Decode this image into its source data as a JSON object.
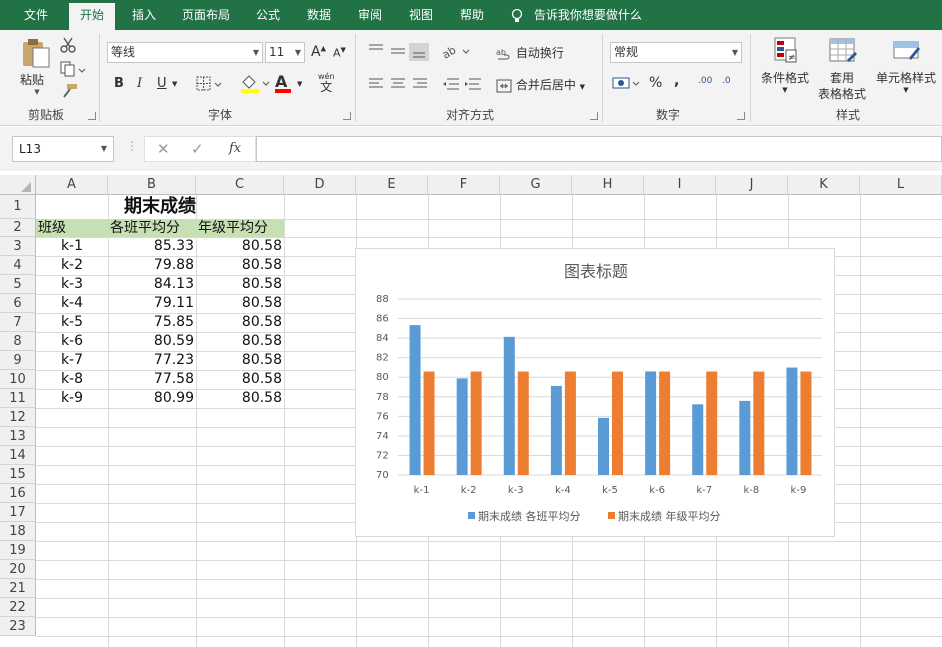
{
  "menu": {
    "tabs": [
      "文件",
      "开始",
      "插入",
      "页面布局",
      "公式",
      "数据",
      "审阅",
      "视图",
      "帮助"
    ],
    "tell_me": "告诉我你想要做什么"
  },
  "ribbon": {
    "clipboard": {
      "paste": "粘贴",
      "label": "剪贴板"
    },
    "font": {
      "name": "等线",
      "size": "11",
      "grow": "A",
      "shrink": "A",
      "bold": "B",
      "italic": "I",
      "underline": "U",
      "font_color_letter": "A",
      "phonetic_top": "wén",
      "phonetic_bottom": "文",
      "label": "字体"
    },
    "alignment": {
      "wrap": "自动换行",
      "merge": "合并后居中",
      "label": "对齐方式"
    },
    "number": {
      "format": "常规",
      "percent": "%",
      "comma": ",",
      "inc_decimal": ".00",
      "dec_decimal": ".0",
      "label": "数字"
    },
    "styles": {
      "conditional": "条件格式",
      "table_line1": "套用",
      "table_line2": "表格格式",
      "cell": "单元格样式",
      "label": "样式"
    }
  },
  "formula_bar": {
    "name_box": "L13",
    "fx": "fx",
    "formula": ""
  },
  "columns": [
    "A",
    "B",
    "C",
    "D",
    "E",
    "F",
    "G",
    "H",
    "I",
    "J",
    "K",
    "L"
  ],
  "rows": [
    "1",
    "2",
    "3",
    "4",
    "5",
    "6",
    "7",
    "8",
    "9",
    "10",
    "11",
    "12",
    "13",
    "14",
    "15",
    "16",
    "17",
    "18",
    "19",
    "20",
    "21",
    "22",
    "23"
  ],
  "sheet": {
    "title": "期末成绩",
    "headers": [
      "班级",
      "各班平均分",
      "年级平均分"
    ],
    "data": [
      [
        "k-1",
        "85.33",
        "80.58"
      ],
      [
        "k-2",
        "79.88",
        "80.58"
      ],
      [
        "k-3",
        "84.13",
        "80.58"
      ],
      [
        "k-4",
        "79.11",
        "80.58"
      ],
      [
        "k-5",
        "75.85",
        "80.58"
      ],
      [
        "k-6",
        "80.59",
        "80.58"
      ],
      [
        "k-7",
        "77.23",
        "80.58"
      ],
      [
        "k-8",
        "77.58",
        "80.58"
      ],
      [
        "k-9",
        "80.99",
        "80.58"
      ]
    ],
    "header_fill": "#c6e0b4"
  },
  "chart_data": {
    "type": "bar",
    "title": "图表标题",
    "categories": [
      "k-1",
      "k-2",
      "k-3",
      "k-4",
      "k-5",
      "k-6",
      "k-7",
      "k-8",
      "k-9"
    ],
    "series": [
      {
        "name": "期末成绩 各班平均分",
        "values": [
          85.33,
          79.88,
          84.13,
          79.11,
          75.85,
          80.59,
          77.23,
          77.58,
          80.99
        ],
        "color": "#5b9bd5"
      },
      {
        "name": "期末成绩 年级平均分",
        "values": [
          80.58,
          80.58,
          80.58,
          80.58,
          80.58,
          80.58,
          80.58,
          80.58,
          80.58
        ],
        "color": "#ed7d31"
      }
    ],
    "ylim": [
      70,
      88
    ],
    "yticks": [
      70,
      72,
      74,
      76,
      78,
      80,
      82,
      84,
      86,
      88
    ],
    "grid": true,
    "legend": "bottom"
  },
  "colors": {
    "brand": "#217346",
    "ribbon_bg": "#f3f3f3",
    "header_bg": "#f0f0f0"
  }
}
